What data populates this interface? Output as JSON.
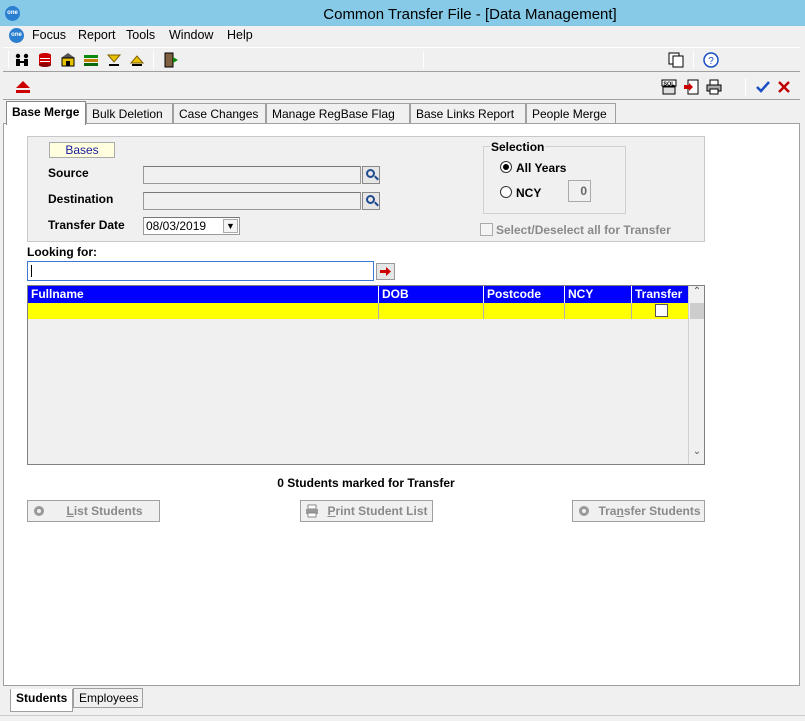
{
  "window": {
    "title": "Common Transfer File - [Data Management]",
    "logo_text": "one"
  },
  "menu": {
    "items": [
      "Focus",
      "Report",
      "Tools",
      "Window",
      "Help"
    ]
  },
  "tabs": [
    "Base Merge",
    "Bulk Deletion",
    "Case Changes",
    "Manage RegBase Flag",
    "Base Links Report",
    "People Merge"
  ],
  "form": {
    "bases_label": "Bases",
    "source_label": "Source",
    "source_value": "",
    "destination_label": "Destination",
    "destination_value": "",
    "transfer_date_label": "Transfer Date",
    "transfer_date_value": "08/03/2019",
    "selection_title": "Selection",
    "opt_all_years": "All Years",
    "opt_ncy": "NCY",
    "ncy_value": "0",
    "select_all_label": "Select/Deselect all for Transfer",
    "looking_for_label": "Looking for:",
    "looking_for_value": ""
  },
  "grid": {
    "columns": [
      "Fullname",
      "DOB",
      "Postcode",
      "NCY",
      "Transfer"
    ]
  },
  "status_text": "0 Students marked for Transfer",
  "buttons": {
    "list_students": {
      "accel": "L",
      "rest": "ist Students"
    },
    "print_student_list": {
      "accel": "P",
      "rest": "rint Student List"
    },
    "transfer_students": {
      "pre": "Tra",
      "accel": "n",
      "rest": "sfer Students"
    }
  },
  "bottom_tabs": [
    "Students",
    "Employees"
  ],
  "colors": {
    "titlebar": "#86cae8",
    "grid_header": "#0000ff",
    "grid_row": "#ffff00",
    "accent_check": "#1a4fc4",
    "accent_cancel": "#c00000"
  }
}
